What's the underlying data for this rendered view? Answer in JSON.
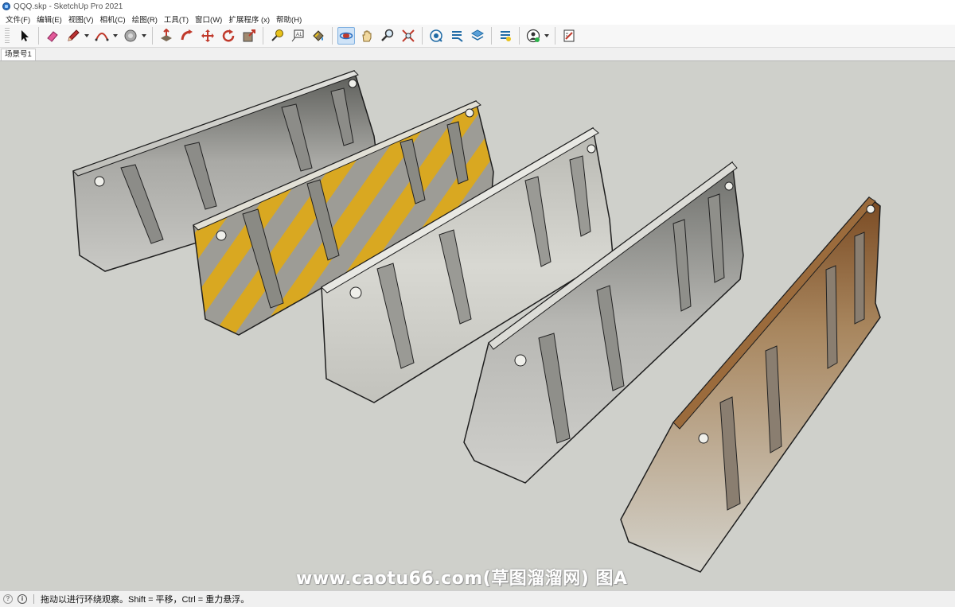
{
  "window": {
    "title": "QQQ.skp - SketchUp Pro 2021"
  },
  "menu": [
    {
      "label": "文件(F)"
    },
    {
      "label": "编辑(E)"
    },
    {
      "label": "视图(V)"
    },
    {
      "label": "相机(C)"
    },
    {
      "label": "绘图(R)"
    },
    {
      "label": "工具(T)"
    },
    {
      "label": "窗口(W)"
    },
    {
      "label": "扩展程序 (x)"
    },
    {
      "label": "帮助(H)"
    }
  ],
  "toolbar": {
    "tools": [
      {
        "icon": "select-arrow-icon"
      },
      {
        "icon": "eraser-icon"
      },
      {
        "icon": "pencil-line-icon",
        "has_dropdown": true
      },
      {
        "icon": "arc-icon",
        "has_dropdown": true
      },
      {
        "icon": "shapes-circle-icon",
        "has_dropdown": true
      },
      {
        "icon": "push-pull-icon"
      },
      {
        "icon": "follow-me-icon"
      },
      {
        "icon": "move-icon"
      },
      {
        "icon": "rotate-icon"
      },
      {
        "icon": "scale-icon"
      },
      {
        "icon": "tape-measure-icon"
      },
      {
        "icon": "text-label-icon"
      },
      {
        "icon": "paint-bucket-icon"
      },
      {
        "icon": "orbit-icon",
        "active": true
      },
      {
        "icon": "pan-hand-icon"
      },
      {
        "icon": "zoom-icon"
      },
      {
        "icon": "zoom-extents-icon"
      },
      {
        "icon": "3d-warehouse-icon"
      },
      {
        "icon": "extension-warehouse-icon"
      },
      {
        "icon": "layout-icon"
      },
      {
        "icon": "extension-manager-icon"
      },
      {
        "icon": "account-icon",
        "has_dropdown": true
      },
      {
        "icon": "send-to-layout-icon"
      }
    ]
  },
  "scene_tabs": [
    {
      "label": "场景号1"
    }
  ],
  "viewport": {
    "background": "#cfd0cb",
    "objects": [
      "concrete-barrier-plain",
      "concrete-barrier-yellow-striped",
      "concrete-barrier-weathered",
      "concrete-barrier-stained",
      "concrete-barrier-rusty"
    ]
  },
  "watermark": {
    "text": "www.caotu66.com(草图溜溜网) 图A"
  },
  "statusbar": {
    "message": "拖动以进行环绕观察。Shift = 平移，Ctrl = 重力悬浮。"
  }
}
